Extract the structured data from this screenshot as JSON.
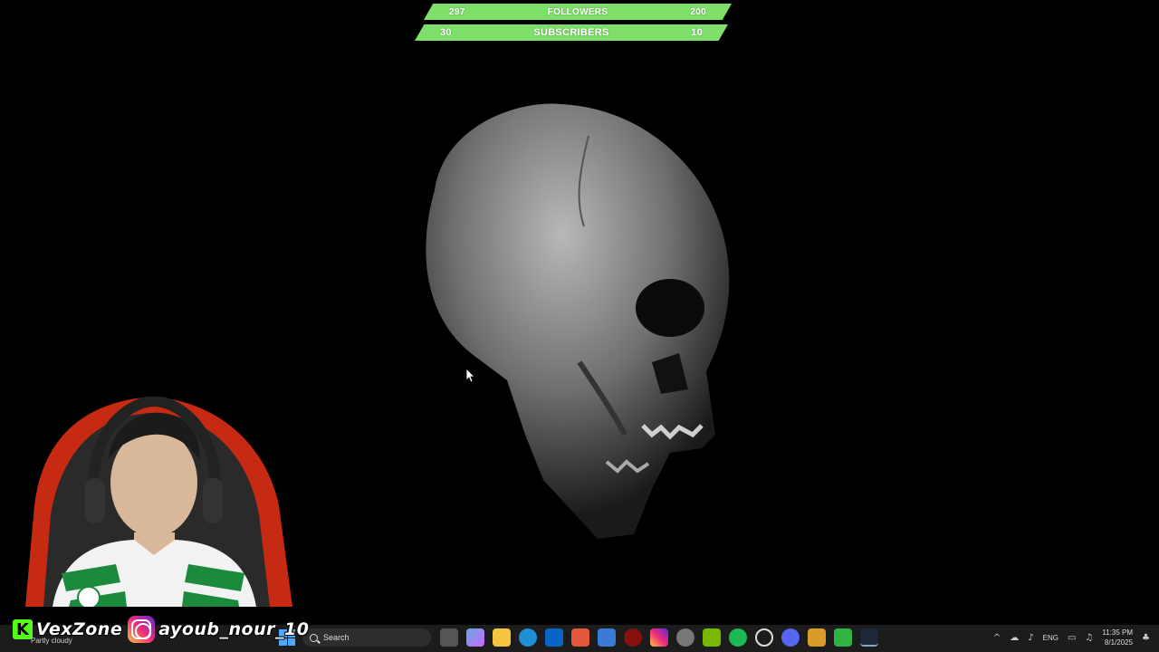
{
  "goals": {
    "followers": {
      "current": "297",
      "label": "FOLLOWERS",
      "target": "200"
    },
    "subscribers": {
      "current": "30",
      "label": "SUBSCRIBERS",
      "target": "10"
    }
  },
  "social": {
    "kick_name": "VexZone",
    "instagram_name": "ayoub_nour_10"
  },
  "taskbar": {
    "weather": "Partly cloudy",
    "search_placeholder": "Search",
    "apps": [
      "file-explorer-icon",
      "copilot-icon",
      "folder-icon",
      "edge-icon",
      "outlook-icon",
      "app-red-icon",
      "store-icon",
      "app-dark-red-icon",
      "instagram-icon",
      "chrome-icon",
      "nvidia-icon",
      "spotify-icon",
      "app-ring-icon",
      "discord-icon",
      "app-mail-icon",
      "app-play-icon",
      "steam-icon"
    ],
    "language": "ENG",
    "time": "11:35 PM",
    "date": "8/1/2025"
  },
  "colors": {
    "goal_green": "#7ee06a",
    "kick_green": "#53fc18"
  }
}
